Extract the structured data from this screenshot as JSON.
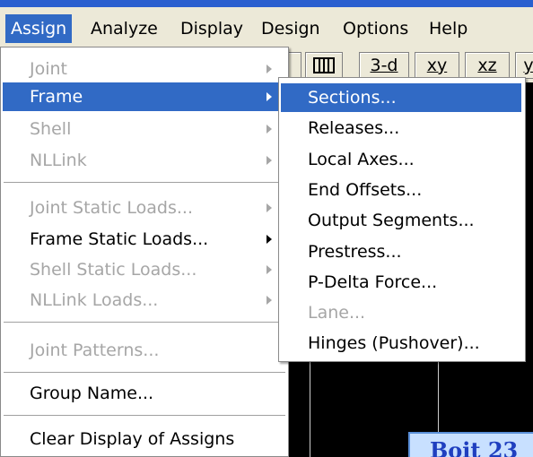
{
  "colors": {
    "highlight": "#316ac5",
    "menubar": "#ece9d8",
    "disabled": "#a6a6a6"
  },
  "menubar": {
    "items": [
      {
        "label": "Assign"
      },
      {
        "label": "Analyze"
      },
      {
        "label": "Display"
      },
      {
        "label": "Design"
      },
      {
        "label": "Options"
      },
      {
        "label": "Help"
      }
    ]
  },
  "toolbar": {
    "buttons": [
      {
        "label": "",
        "icon": "frame-view-icon"
      },
      {
        "label": "3-d"
      },
      {
        "label": "xy"
      },
      {
        "label": "xz"
      },
      {
        "label": "yz"
      }
    ]
  },
  "assign_menu": {
    "items": [
      {
        "label": "Joint"
      },
      {
        "label": "Frame"
      },
      {
        "label": "Shell"
      },
      {
        "label": "NLLink"
      },
      {
        "label": "Joint Static Loads..."
      },
      {
        "label": "Frame Static Loads..."
      },
      {
        "label": "Shell Static Loads..."
      },
      {
        "label": "NLLink Loads..."
      },
      {
        "label": "Joint Patterns..."
      },
      {
        "label": "Group Name..."
      },
      {
        "label": "Clear Display of Assigns"
      }
    ]
  },
  "frame_submenu": {
    "items": [
      {
        "label": "Sections..."
      },
      {
        "label": "Releases..."
      },
      {
        "label": "Local Axes..."
      },
      {
        "label": "End Offsets..."
      },
      {
        "label": "Output Segments..."
      },
      {
        "label": "Prestress..."
      },
      {
        "label": "P-Delta Force..."
      },
      {
        "label": "Lane..."
      },
      {
        "label": "Hinges (Pushover)..."
      }
    ]
  },
  "background": {
    "corner_text": "Boit 23"
  }
}
